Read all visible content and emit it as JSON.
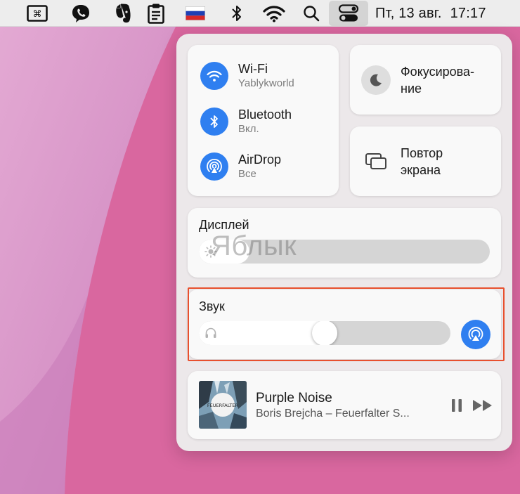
{
  "menubar": {
    "icons": [
      "command-icon",
      "viber-icon",
      "evernote-icon",
      "clipboard-icon",
      "russian-flag-icon",
      "bluetooth-icon",
      "wifi-icon",
      "search-icon",
      "control-center-icon"
    ],
    "day_date": "Пт, 13 авг.",
    "time": "17:17"
  },
  "control_center": {
    "connectivity": [
      {
        "title": "Wi-Fi",
        "subtitle": "Yablykworld",
        "icon": "wifi-icon"
      },
      {
        "title": "Bluetooth",
        "subtitle": "Вкл.",
        "icon": "bluetooth-icon"
      },
      {
        "title": "AirDrop",
        "subtitle": "Все",
        "icon": "airdrop-icon"
      }
    ],
    "focus": {
      "label": "Фокусирова-\nние",
      "icon": "moon-icon"
    },
    "mirroring": {
      "label": "Повтор\nэкрана",
      "icon": "screen-mirroring-icon"
    },
    "display": {
      "title": "Дисплей",
      "brightness": 0.32,
      "icon": "brightness-icon"
    },
    "sound": {
      "title": "Звук",
      "volume": 0.5,
      "icon": "headphones-icon",
      "output_icon": "airplay-audio-icon"
    },
    "now_playing": {
      "title": "Purple Noise",
      "artist": "Boris Brejcha – Feuerfalter S...",
      "album_text": "FEUERFALTER",
      "controls": [
        "pause-icon",
        "forward-icon"
      ]
    }
  },
  "watermark": "Яблык",
  "colors": {
    "accent": "#2f7ff0",
    "highlight": "#e8502e",
    "wallpaper": "#d672aa"
  }
}
